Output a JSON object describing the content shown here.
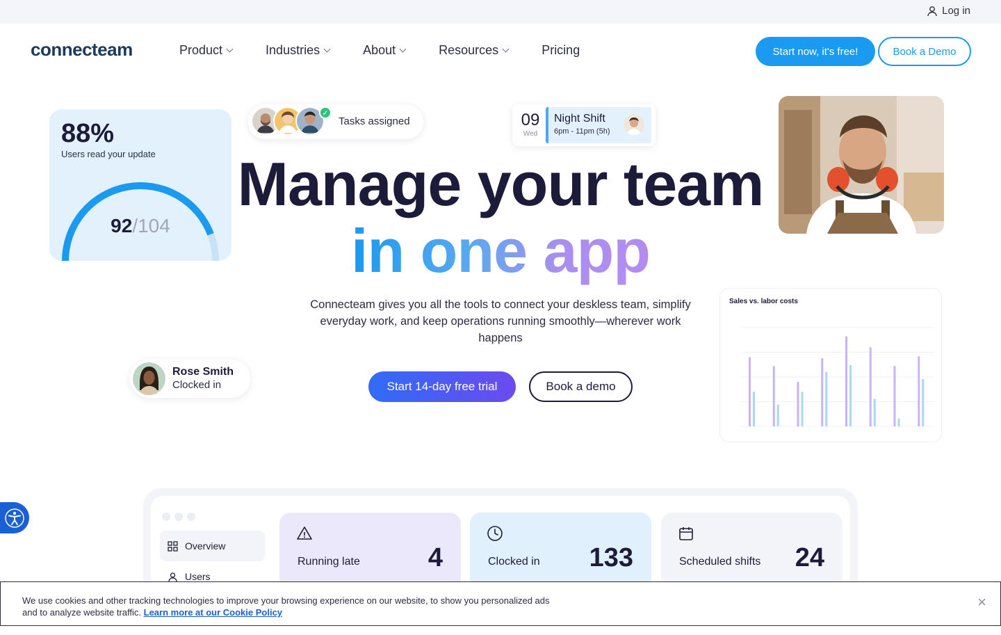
{
  "topbar": {
    "login_label": "Log in"
  },
  "nav": {
    "logo": "connecteam",
    "links": [
      {
        "label": "Product",
        "dropdown": true
      },
      {
        "label": "Industries",
        "dropdown": true
      },
      {
        "label": "About",
        "dropdown": true
      },
      {
        "label": "Resources",
        "dropdown": true
      },
      {
        "label": "Pricing",
        "dropdown": false
      }
    ],
    "cta_start": "Start now, it's free!",
    "cta_demo": "Book a Demo"
  },
  "read_card": {
    "percent": "88%",
    "subtitle": "Users read your update",
    "read_count": "92",
    "separator": "/",
    "total": "104",
    "progress": 0.885
  },
  "tasks_pill": {
    "label": "Tasks assigned"
  },
  "shift_card": {
    "day": "09",
    "weekday": "Wed",
    "title": "Night Shift",
    "time": "6pm - 11pm (5h)"
  },
  "hero": {
    "title_line1": "Manage your team",
    "title_line2": "in one app",
    "lead": "Connecteam gives you all the tools to connect your deskless team, simplify everyday work, and keep operations running smoothly—wherever work happens",
    "cta_trial": "Start 14-day free trial",
    "cta_demo": "Book a demo"
  },
  "rose_pill": {
    "name": "Rose Smith",
    "status": "Clocked in"
  },
  "chart_data": {
    "type": "bar",
    "title": "Sales vs. labor costs",
    "categories": [
      "",
      "",
      "",
      "",
      "",
      "",
      "",
      ""
    ],
    "series": [
      {
        "values": [
          0.7,
          0.61,
          0.45,
          0.69,
          0.91,
          0.8,
          0.61,
          0.71
        ]
      },
      {
        "values": [
          0.35,
          0.22,
          0.35,
          0.55,
          0.62,
          0.28,
          0.08,
          0.48
        ]
      }
    ],
    "colors": [
      "#c6b4f3",
      "#a9d8f5"
    ],
    "grid": true
  },
  "dashboard": {
    "sidebar": [
      {
        "label": "Overview",
        "icon": "grid-icon",
        "active": true
      },
      {
        "label": "Users",
        "icon": "user-icon",
        "active": false
      }
    ],
    "stats": [
      {
        "label": "Running late",
        "value": "4",
        "icon": "warning-icon",
        "bg": "#ece8fb"
      },
      {
        "label": "Clocked in",
        "value": "133",
        "icon": "clock-icon",
        "bg": "#e0f0fd"
      },
      {
        "label": "Scheduled shifts",
        "value": "24",
        "icon": "calendar-icon",
        "bg": "#f3f4f9"
      }
    ]
  },
  "cookie": {
    "text": "We use cookies and other tracking technologies to improve your browsing experience on our website, to show you personalized ads and to analyze website traffic. ",
    "link": "Learn more at our Cookie Policy",
    "close": "×"
  }
}
